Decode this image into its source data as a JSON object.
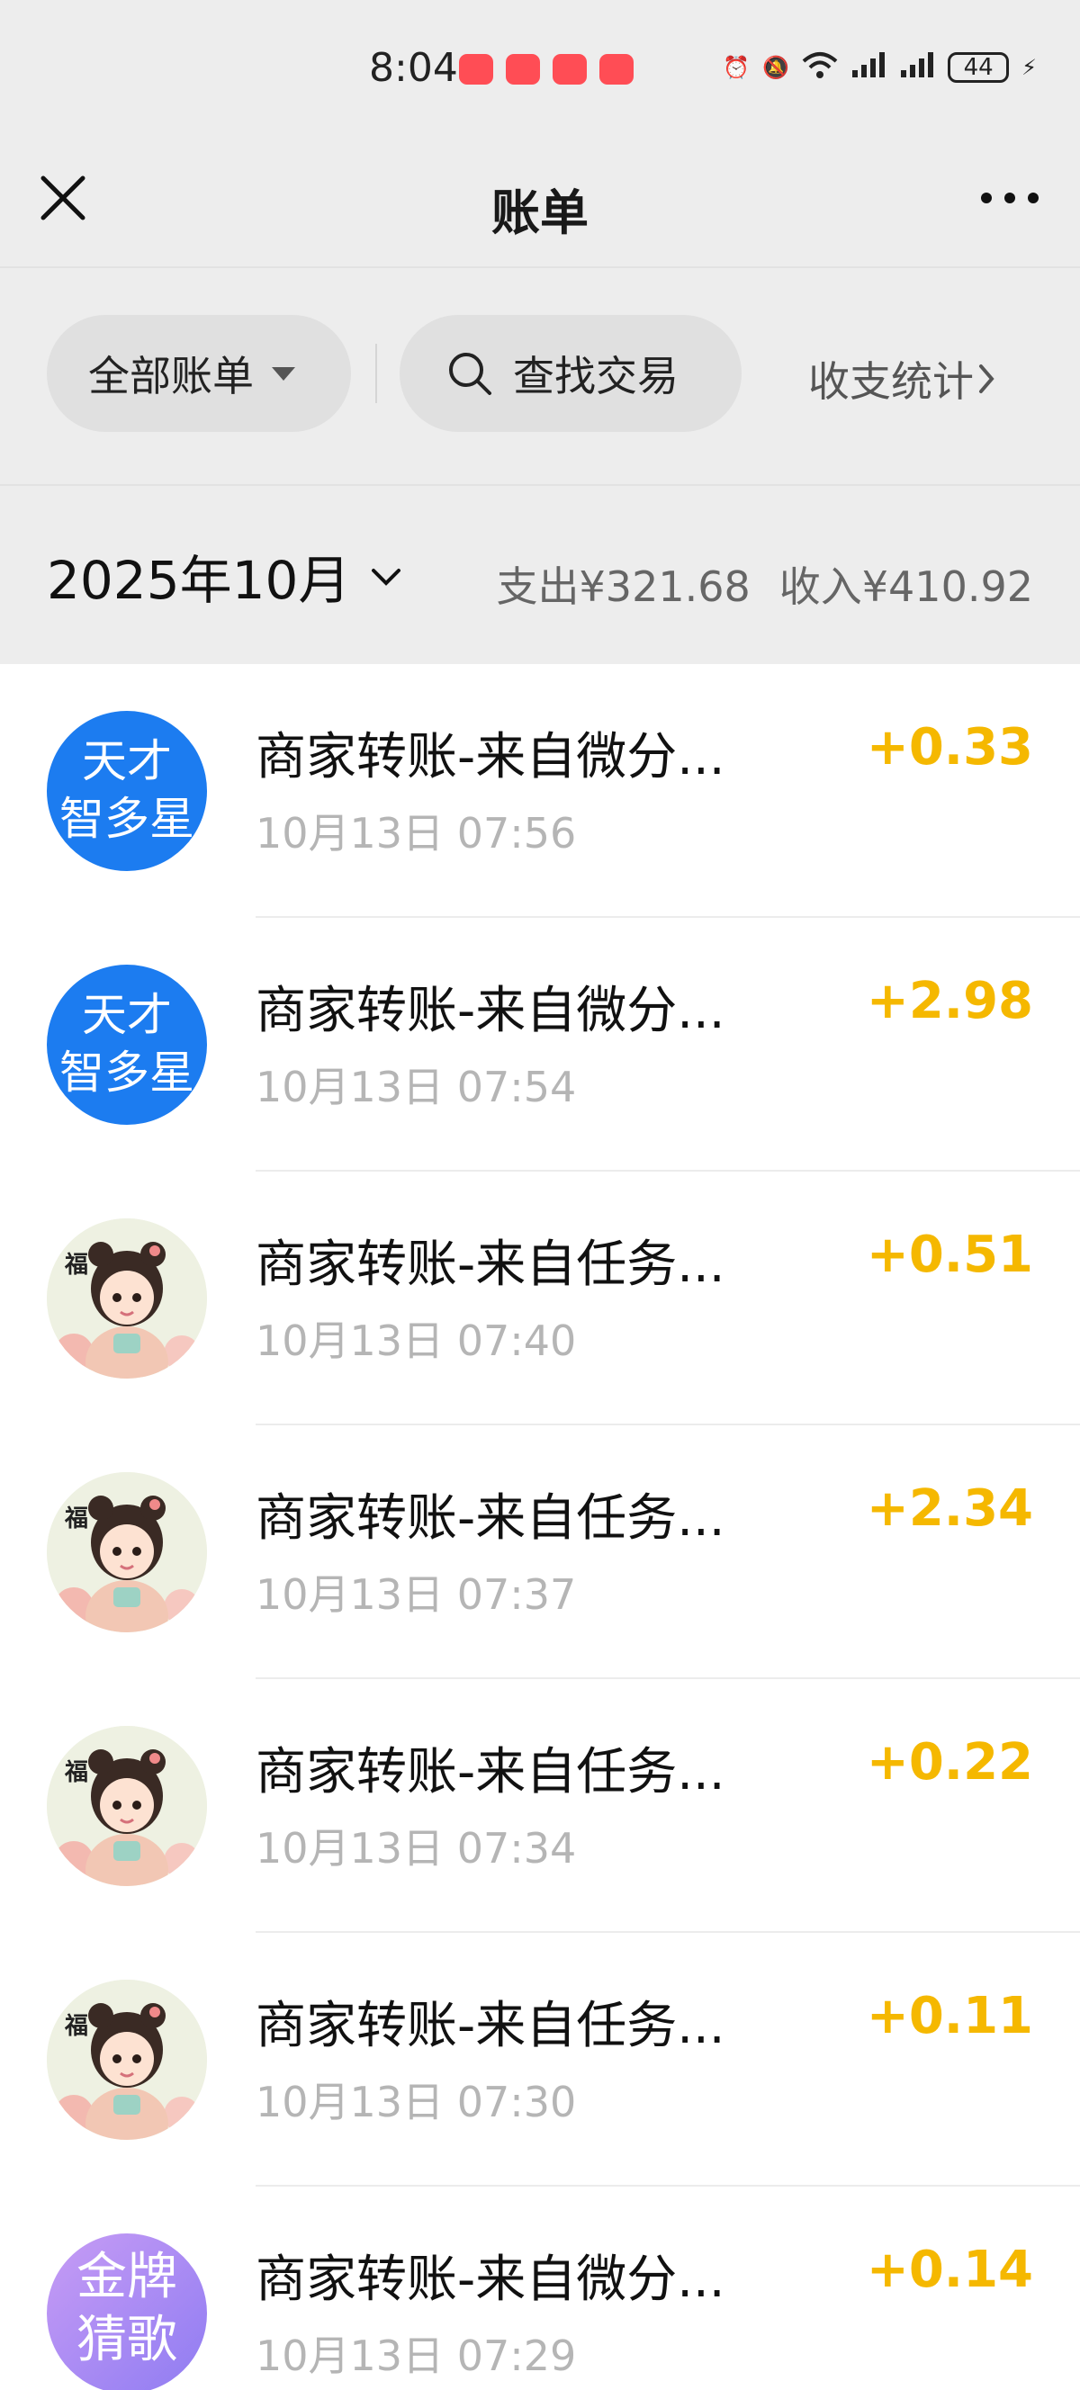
{
  "status_bar": {
    "time": "8:04",
    "battery": "44",
    "icons": [
      "alarm-icon",
      "mute-icon",
      "wifi-icon",
      "signal-4g-icon",
      "signal-4g-icon",
      "charging-icon"
    ]
  },
  "nav": {
    "title": "账单",
    "close_icon": "close-icon",
    "more_icon": "more-icon"
  },
  "filter": {
    "all_bills": "全部账单",
    "search": "查找交易",
    "stats": "收支统计"
  },
  "summary": {
    "month": "2025年10月",
    "expense": "支出¥321.68",
    "income": "收入¥410.92"
  },
  "colors": {
    "amount": "#f5b800",
    "blue_avatar": "#1c7cf0"
  },
  "transactions": [
    {
      "avatar_type": "blue",
      "avatar_text": "天才\n智多星",
      "title": "商家转账-来自微分...",
      "time": "10月13日 07:56",
      "amount": "+0.33"
    },
    {
      "avatar_type": "blue",
      "avatar_text": "天才\n智多星",
      "title": "商家转账-来自微分...",
      "time": "10月13日 07:54",
      "amount": "+2.98"
    },
    {
      "avatar_type": "girl",
      "avatar_text": "",
      "title": "商家转账-来自任务...",
      "time": "10月13日 07:40",
      "amount": "+0.51"
    },
    {
      "avatar_type": "girl",
      "avatar_text": "",
      "title": "商家转账-来自任务...",
      "time": "10月13日 07:37",
      "amount": "+2.34"
    },
    {
      "avatar_type": "girl",
      "avatar_text": "",
      "title": "商家转账-来自任务...",
      "time": "10月13日 07:34",
      "amount": "+0.22"
    },
    {
      "avatar_type": "girl",
      "avatar_text": "",
      "title": "商家转账-来自任务...",
      "time": "10月13日 07:30",
      "amount": "+0.11"
    },
    {
      "avatar_type": "purple",
      "avatar_text": "金牌\n猜歌",
      "title": "商家转账-来自微分...",
      "time": "10月13日 07:29",
      "amount": "+0.14"
    }
  ]
}
